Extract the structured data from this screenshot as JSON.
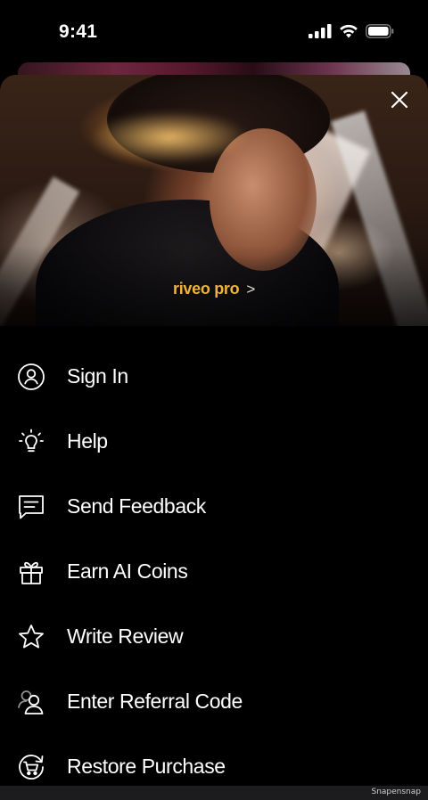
{
  "status_bar": {
    "time": "9:41",
    "icons": [
      "cellular-signal-icon",
      "wifi-icon",
      "battery-icon"
    ]
  },
  "hero": {
    "pro_label": "riveo pro",
    "pro_chevron": ">",
    "close_icon": "close-icon",
    "accent_color": "#f0b43c"
  },
  "menu": {
    "items": [
      {
        "label": "Sign In",
        "icon": "user-circle-icon"
      },
      {
        "label": "Help",
        "icon": "lightbulb-icon"
      },
      {
        "label": "Send Feedback",
        "icon": "message-icon"
      },
      {
        "label": "Earn AI Coins",
        "icon": "gift-icon"
      },
      {
        "label": "Write Review",
        "icon": "star-icon"
      },
      {
        "label": "Enter Referral Code",
        "icon": "users-icon"
      },
      {
        "label": "Restore Purchase",
        "icon": "restore-cart-icon"
      }
    ]
  },
  "watermark": "Snapensnap"
}
